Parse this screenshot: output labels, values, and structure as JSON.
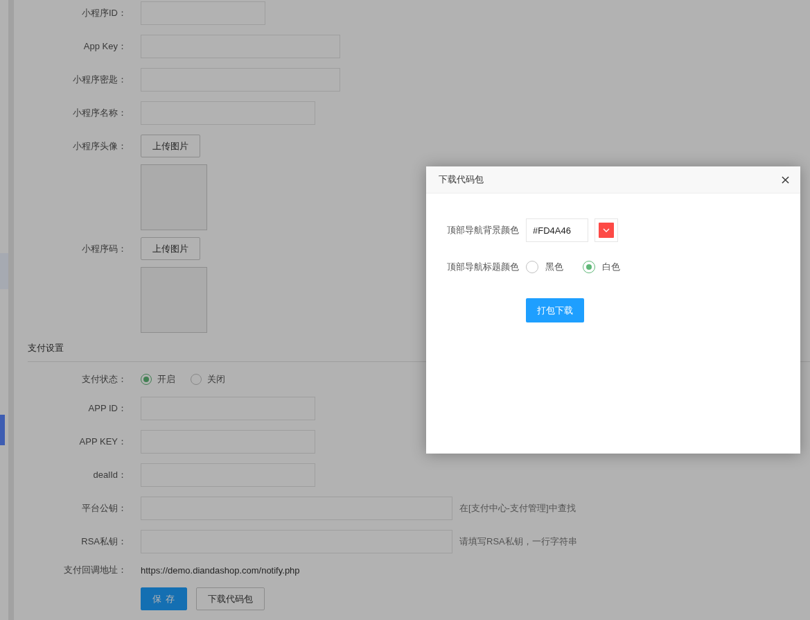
{
  "mini_program_fields": [
    {
      "kind": "input",
      "label": "小程序ID："
    },
    {
      "kind": "input",
      "label": "App Key："
    },
    {
      "kind": "input",
      "label": "小程序密匙："
    },
    {
      "kind": "input",
      "label": "小程序名称："
    },
    {
      "kind": "upload",
      "label": "小程序头像：",
      "button": "上传图片"
    },
    {
      "kind": "upload",
      "label": "小程序码：",
      "button": "上传图片"
    }
  ],
  "payment_section": {
    "title": "支付设置",
    "fields": [
      {
        "kind": "radio",
        "label": "支付状态：",
        "options": [
          {
            "label": "开启",
            "selected": true
          },
          {
            "label": "关闭",
            "selected": false
          }
        ]
      },
      {
        "kind": "input",
        "label": "APP ID："
      },
      {
        "kind": "input",
        "label": "APP KEY："
      },
      {
        "kind": "input",
        "label": "dealId："
      },
      {
        "kind": "input",
        "label": "平台公钥：",
        "hint": "在[支付中心-支付管理]中查找"
      },
      {
        "kind": "input",
        "label": "RSA私钥：",
        "hint": "请填写RSA私钥，一行字符串"
      },
      {
        "kind": "text",
        "label": "支付回调地址：",
        "value": "https://demo.diandashop.com/notify.php"
      }
    ]
  },
  "buttons": [
    {
      "kind": "primary",
      "label": "保 存"
    },
    {
      "kind": "default",
      "label": "下载代码包"
    }
  ],
  "dialog": {
    "title": "下载代码包",
    "fields": [
      {
        "kind": "color",
        "label": "顶部导航背景颜色",
        "value": "#FD4A46",
        "color": "#fd4a46"
      },
      {
        "kind": "radio",
        "label": "顶部导航标题颜色",
        "options": [
          {
            "label": "黑色",
            "selected": false
          },
          {
            "label": "白色",
            "selected": true
          }
        ]
      }
    ],
    "button": "打包下载"
  }
}
